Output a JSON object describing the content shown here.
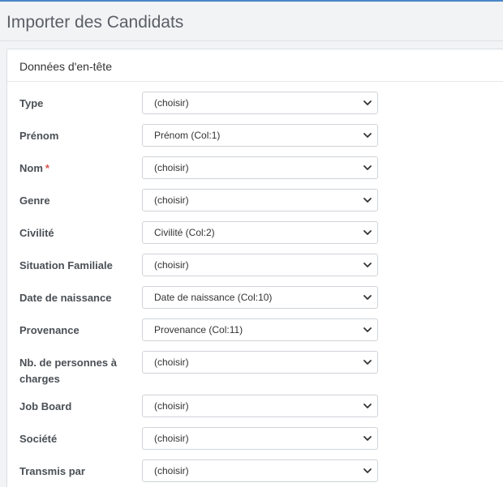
{
  "page": {
    "title": "Importer des Candidats"
  },
  "panel": {
    "title": "Données d'en-tête"
  },
  "fields": [
    {
      "label": "Type",
      "value": "(choisir)",
      "required": false
    },
    {
      "label": "Prénom",
      "value": "Prénom (Col:1)",
      "required": false
    },
    {
      "label": "Nom",
      "value": "(choisir)",
      "required": true
    },
    {
      "label": "Genre",
      "value": "(choisir)",
      "required": false
    },
    {
      "label": "Civilité",
      "value": "Civilité (Col:2)",
      "required": false
    },
    {
      "label": "Situation Familiale",
      "value": "(choisir)",
      "required": false
    },
    {
      "label": "Date de naissance",
      "value": "Date de naissance (Col:10)",
      "required": false
    },
    {
      "label": "Provenance",
      "value": "Provenance (Col:11)",
      "required": false
    },
    {
      "label": "Nb. de personnes à charges",
      "value": "(choisir)",
      "required": false
    },
    {
      "label": "Job Board",
      "value": "(choisir)",
      "required": false
    },
    {
      "label": "Société",
      "value": "(choisir)",
      "required": false
    },
    {
      "label": "Transmis par",
      "value": "(choisir)",
      "required": false
    }
  ],
  "required_marker": "*",
  "colors": {
    "accent": "#4a86c5",
    "required": "#d9534f"
  }
}
